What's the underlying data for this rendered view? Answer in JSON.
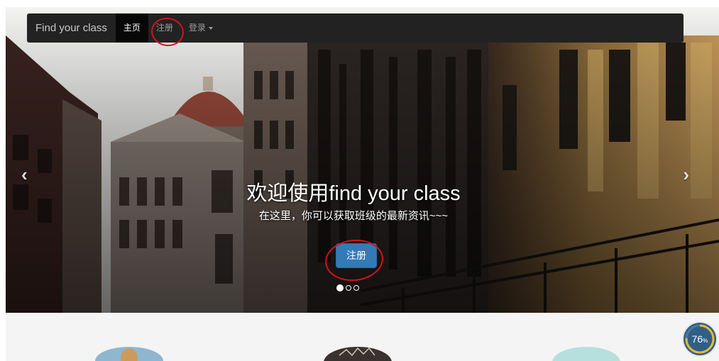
{
  "navbar": {
    "brand": "Find your class",
    "items": [
      {
        "label": "主页",
        "active": true
      },
      {
        "label": "注册",
        "active": false
      },
      {
        "label": "登录",
        "active": false,
        "dropdown": true
      }
    ]
  },
  "carousel": {
    "heading": "欢迎使用find your class",
    "subheading": "在这里，你可以获取班级的最新资讯~~~",
    "button_label": "注册",
    "prev_icon": "‹",
    "next_icon": "›",
    "slide_count": 3,
    "active_slide": 1
  },
  "gauge": {
    "value": "76",
    "unit": "%",
    "fraction": 0.76,
    "color": "#f2b632"
  },
  "colors": {
    "navbar_bg": "#222222",
    "primary_button": "#337ab7",
    "annotation": "#d0131b"
  }
}
